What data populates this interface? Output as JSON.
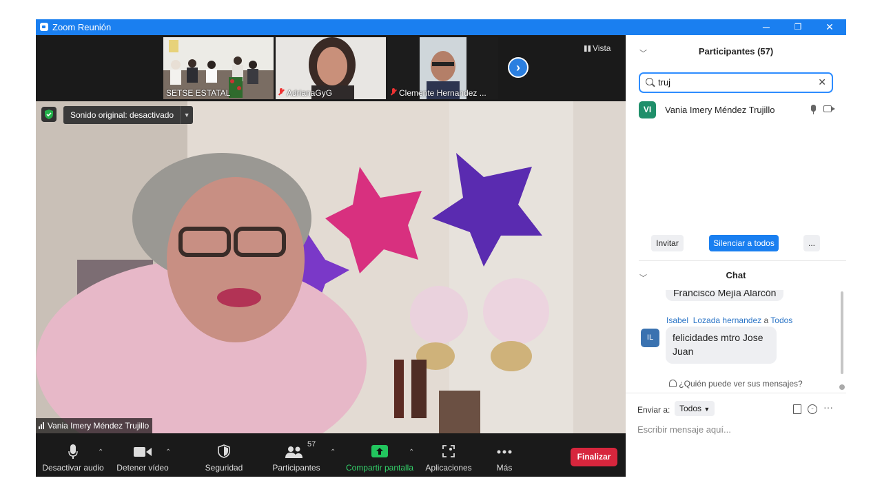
{
  "window": {
    "title": "Zoom Reunión",
    "minimize": "─",
    "restore": "❐",
    "close": "✕"
  },
  "strip": {
    "thumbs": [
      {
        "name": "SETSE ESTATAL",
        "muted": false
      },
      {
        "name": "AdrianaGyG",
        "muted": true
      },
      {
        "name": "Clemente Hernandez ...",
        "muted": true
      }
    ],
    "next_icon": "chevron-right-icon",
    "view_label": "Vista"
  },
  "main_video": {
    "sound_label": "Sonido original: desactivado",
    "speaker_name": "Vania Imery Méndez Trujillo"
  },
  "toolbar": {
    "audio": "Desactivar audio",
    "video": "Detener vídeo",
    "security": "Seguridad",
    "participants": "Participantes",
    "participants_count": "57",
    "share": "Compartir pantalla",
    "apps": "Aplicaciones",
    "more": "Más",
    "end": "Finalizar"
  },
  "panel": {
    "participants_title": "Participantes (57)",
    "search_value": "truj",
    "result": {
      "initials": "VI",
      "name": "Vania Imery Méndez Trujillo"
    },
    "invite": "Invitar",
    "mute_all": "Silenciar a todos",
    "more": "...",
    "chat_title": "Chat",
    "prev_message": "Francisco Mejía Alarcón",
    "msg_sender_first": "Isabel",
    "msg_sender_last": "Lozada hernandez",
    "msg_to_word": "a",
    "msg_to": "Todos",
    "msg_initials": "IL",
    "msg_line1": "felicidades mtro Jose",
    "msg_line2": "Juan",
    "who_can_see": "¿Quién puede ver sus mensajes?",
    "send_to_label": "Enviar a:",
    "send_to_value": "Todos",
    "input_placeholder": "Escribir mensaje aquí..."
  },
  "colors": {
    "accent": "#2d8cff",
    "titlebar": "#1a7ff0",
    "end": "#d7263d",
    "share": "#22c55e"
  }
}
